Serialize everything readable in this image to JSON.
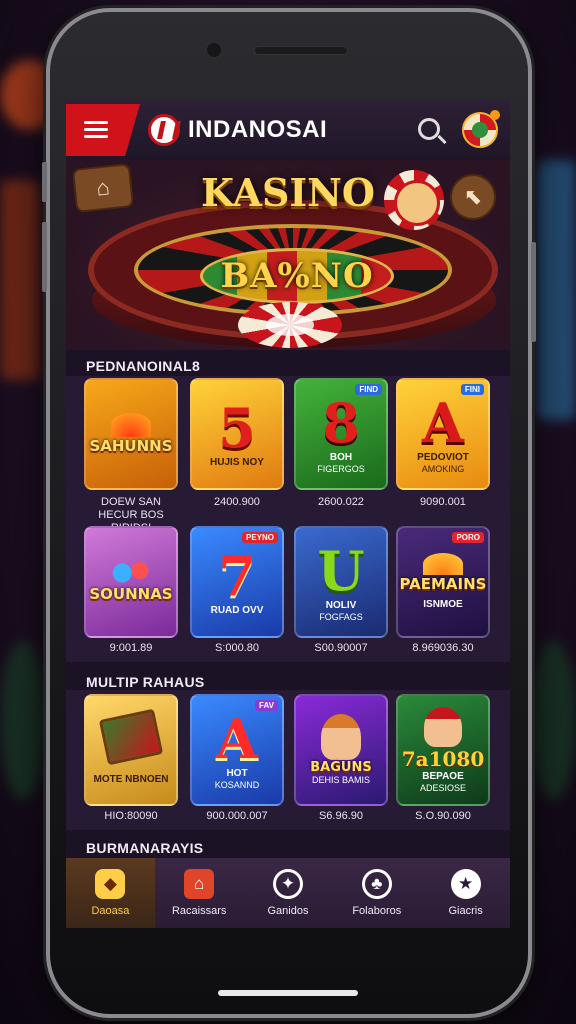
{
  "app": {
    "brand": "INDANOSAI"
  },
  "hero": {
    "title": "KASINO",
    "wheel_text": "BA%NO"
  },
  "sections": [
    {
      "label": "PEDNANOINAL8",
      "tiles": [
        {
          "big": "",
          "word": "SAHUNNS",
          "cap": "",
          "sub": "",
          "tag": "",
          "amount": "DOEW SAN\nHECUR BOS RIRIDSI"
        },
        {
          "big": "5",
          "word": "",
          "cap": "HUJIS NOY",
          "sub": "",
          "tag": "",
          "amount": "2400.900"
        },
        {
          "big": "8",
          "word": "",
          "cap": "BOH",
          "sub": "FIGERGOS",
          "tag": "FIND",
          "amount": "2600.022"
        },
        {
          "big": "A",
          "word": "",
          "cap": "PEDOVIOT",
          "sub": "AMOKING",
          "tag": "FINI",
          "amount": "9090.001"
        },
        {
          "big": "",
          "word": "SOUNNAS",
          "cap": "",
          "sub": "",
          "tag": "",
          "amount": "9:001.89"
        },
        {
          "big": "7",
          "word": "",
          "cap": "RUAD OVV",
          "sub": "",
          "tag": "PEYNO",
          "amount": "S:000.80"
        },
        {
          "big": "U",
          "word": "",
          "cap": "NOLIV",
          "sub": "FOGFAGS",
          "tag": "",
          "amount": "S00.90007"
        },
        {
          "big": "",
          "word": "PAEMAINS",
          "cap": "ISNMOE",
          "sub": "",
          "tag": "PORO",
          "amount": "8.969036.30"
        }
      ]
    },
    {
      "label": "MULTIP RAHAUS",
      "tiles": [
        {
          "big": "",
          "word": "",
          "cap": "MOTE NBNOEN",
          "sub": "",
          "tag": "",
          "amount": "HIO:80090"
        },
        {
          "big": "A",
          "word": "",
          "cap": "HOT",
          "sub": "KOSANND",
          "tag": "FAV",
          "amount": "900.000.007"
        },
        {
          "big": "",
          "word": "BAGUNS",
          "cap": "",
          "sub": "DEHIS BAMIS",
          "tag": "",
          "amount": "S6.96.90"
        },
        {
          "big": "7a1080",
          "word": "",
          "cap": "BEPAOE",
          "sub": "ADESIOSE",
          "tag": "",
          "amount": "S.O.90.090"
        }
      ]
    },
    {
      "label": "BURMANARAYIS"
    }
  ],
  "nav": [
    {
      "label": "Daoasa",
      "icon": "bag-icon"
    },
    {
      "label": "Racaissars",
      "icon": "house-icon"
    },
    {
      "label": "Ganidos",
      "icon": "wheel-icon"
    },
    {
      "label": "Folaboros",
      "icon": "cards-icon"
    },
    {
      "label": "Giacris",
      "icon": "star-badge-icon"
    }
  ],
  "colors": {
    "accent": "#d0121a",
    "gold": "#ffce48",
    "panel": "#271a35"
  }
}
